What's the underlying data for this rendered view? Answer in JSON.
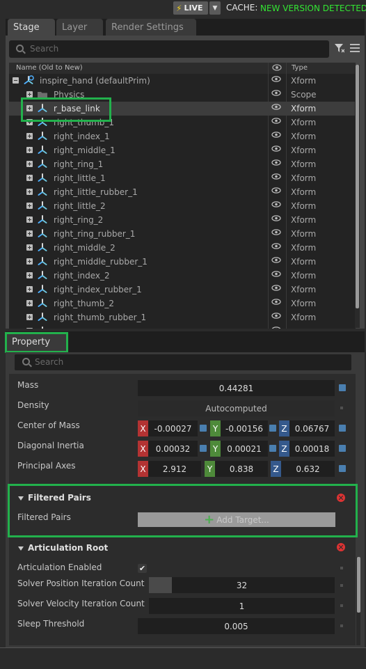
{
  "topbar": {
    "live_label": "LIVE",
    "cache_label": "CACHE:",
    "cache_status": "NEW VERSION DETECTED",
    "cache_status_color": "#33e633"
  },
  "stage": {
    "tabs": [
      {
        "label": "Stage",
        "active": true
      },
      {
        "label": "Layer",
        "active": false
      },
      {
        "label": "Render Settings",
        "active": false
      }
    ],
    "search_placeholder": "Search",
    "columns": {
      "name": "Name (Old to New)",
      "type": "Type"
    },
    "root": {
      "name": "inspire_hand (defaultPrim)",
      "type": "Xform"
    },
    "rows": [
      {
        "name": "Physics",
        "type": "Scope",
        "icon": "folder-icon"
      },
      {
        "name": "r_base_link",
        "type": "Xform",
        "icon": "xform-icon",
        "selected": true
      },
      {
        "name": "right_thumb_1",
        "type": "Xform",
        "icon": "xform-icon"
      },
      {
        "name": "right_index_1",
        "type": "Xform",
        "icon": "xform-icon"
      },
      {
        "name": "right_middle_1",
        "type": "Xform",
        "icon": "xform-icon"
      },
      {
        "name": "right_ring_1",
        "type": "Xform",
        "icon": "xform-icon"
      },
      {
        "name": "right_little_1",
        "type": "Xform",
        "icon": "xform-icon"
      },
      {
        "name": "right_little_rubber_1",
        "type": "Xform",
        "icon": "xform-icon"
      },
      {
        "name": "right_little_2",
        "type": "Xform",
        "icon": "xform-icon"
      },
      {
        "name": "right_ring_2",
        "type": "Xform",
        "icon": "xform-icon"
      },
      {
        "name": "right_ring_rubber_1",
        "type": "Xform",
        "icon": "xform-icon"
      },
      {
        "name": "right_middle_2",
        "type": "Xform",
        "icon": "xform-icon"
      },
      {
        "name": "right_middle_rubber_1",
        "type": "Xform",
        "icon": "xform-icon"
      },
      {
        "name": "right_index_2",
        "type": "Xform",
        "icon": "xform-icon"
      },
      {
        "name": "right_index_rubber_1",
        "type": "Xform",
        "icon": "xform-icon"
      },
      {
        "name": "right_thumb_2",
        "type": "Xform",
        "icon": "xform-icon"
      },
      {
        "name": "right_thumb_rubber_1",
        "type": "Xform",
        "icon": "xform-icon"
      }
    ]
  },
  "property": {
    "tab_label": "Property",
    "search_placeholder": "Search",
    "mass": {
      "label": "Mass",
      "value": "0.44281"
    },
    "density": {
      "label": "Density",
      "value": "Autocomputed"
    },
    "center_of_mass": {
      "label": "Center of Mass",
      "x": "-0.00027",
      "y": "-0.00156",
      "z": "0.06767"
    },
    "diagonal_inertia": {
      "label": "Diagonal Inertia",
      "x": "0.00032",
      "y": "0.00021",
      "z": "0.00018"
    },
    "principal_axes": {
      "label": "Principal Axes",
      "x": "2.912",
      "y": "0.838",
      "z": "0.632"
    },
    "axis_labels": {
      "x": "X",
      "y": "Y",
      "z": "Z"
    },
    "filtered_pairs": {
      "title": "Filtered Pairs",
      "field_label": "Filtered Pairs",
      "button_label": "Add Target..."
    },
    "articulation_root": {
      "title": "Articulation Root",
      "enabled_label": "Articulation Enabled",
      "enabled": true,
      "solver_position_label": "Solver Position Iteration Count",
      "solver_position_value": "32",
      "solver_velocity_label": "Solver Velocity Iteration Count",
      "solver_velocity_value": "1",
      "sleep_threshold_label": "Sleep Threshold",
      "sleep_threshold_value": "0.005"
    }
  },
  "colors": {
    "highlight": "#22b14c",
    "axis_x": "#b33333",
    "axis_y": "#4e8a3a",
    "axis_z": "#35598c"
  }
}
